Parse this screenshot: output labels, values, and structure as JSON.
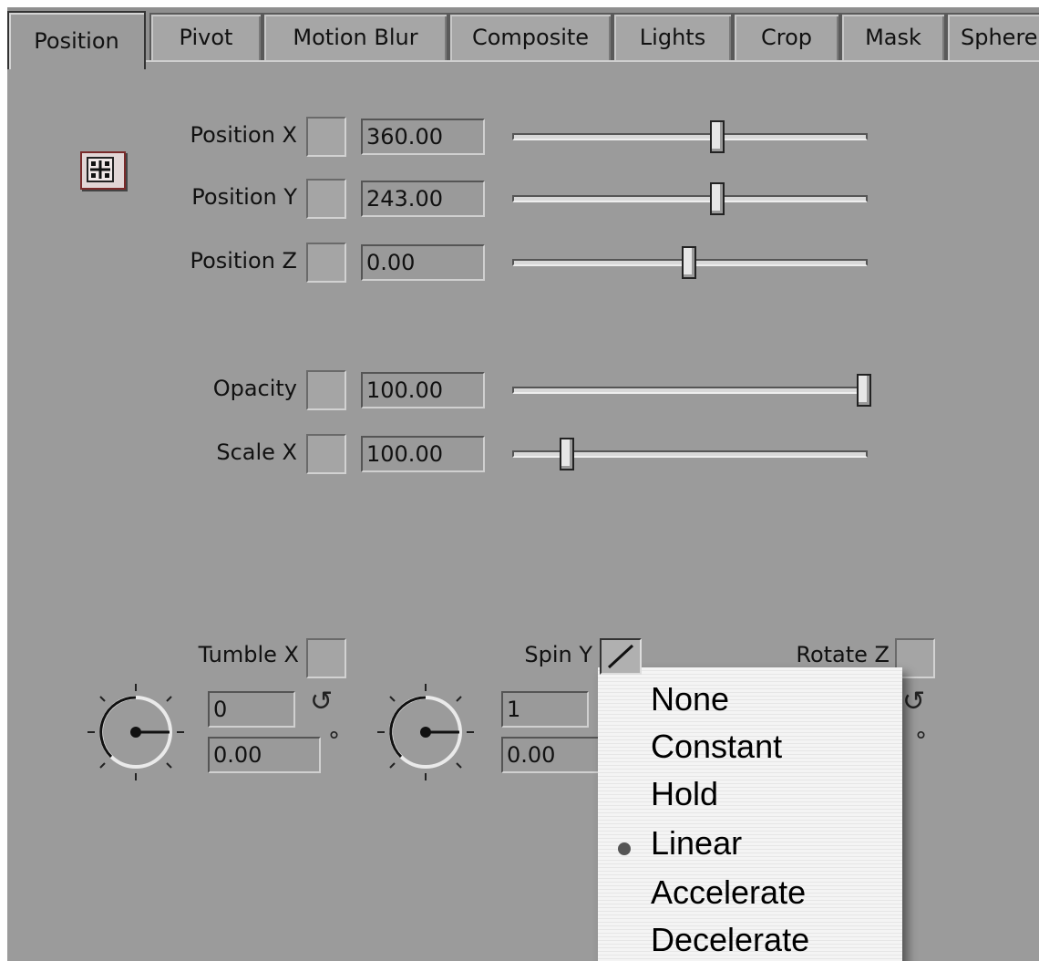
{
  "tabs": [
    {
      "label": "Position",
      "active": true
    },
    {
      "label": "Pivot",
      "active": false
    },
    {
      "label": "Motion Blur",
      "active": false
    },
    {
      "label": "Composite",
      "active": false
    },
    {
      "label": "Lights",
      "active": false
    },
    {
      "label": "Crop",
      "active": false
    },
    {
      "label": "Mask",
      "active": false
    },
    {
      "label": "Sphere",
      "active": false
    }
  ],
  "params": [
    {
      "label": "Position X",
      "value": "360.00",
      "slider_fraction": 0.58
    },
    {
      "label": "Position Y",
      "value": "243.00",
      "slider_fraction": 0.58
    },
    {
      "label": "Position Z",
      "value": "0.00",
      "slider_fraction": 0.5
    },
    {
      "label": "Opacity",
      "value": "100.00",
      "slider_fraction": 1.0
    },
    {
      "label": "Scale X",
      "value": "100.00",
      "slider_fraction": 0.15
    }
  ],
  "rotations": [
    {
      "label": "Tumble X",
      "revolutions": "0",
      "degrees": "0.00"
    },
    {
      "label": "Spin Y",
      "revolutions": "1",
      "degrees": "0.00"
    },
    {
      "label": "Rotate Z",
      "revolutions": "",
      "degrees": ""
    }
  ],
  "interpolation_menu": {
    "items": [
      "None",
      "Constant",
      "Hold",
      "Linear",
      "Accelerate",
      "Decelerate"
    ],
    "selected": "Linear"
  },
  "icons": {
    "reset": "rotate-reset-icon",
    "degree": "degree-symbol",
    "position": "move-crosshair-icon"
  },
  "colors": {
    "panel": "#9b9b9b",
    "menu": "#f2f2f2",
    "bullet": "#555555"
  }
}
